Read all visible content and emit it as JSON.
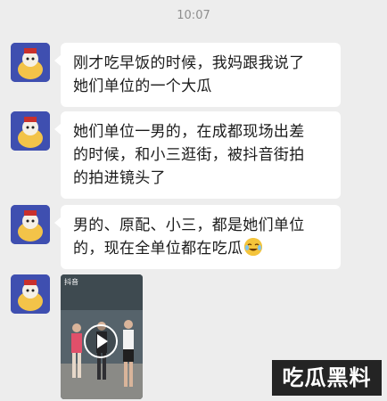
{
  "header": {
    "time": "10:07"
  },
  "messages": [
    {
      "avatar": "ip-mascot-avatar",
      "text": "刚才吃早饭的时候，我妈跟我说了\n她们单位的一个大瓜"
    },
    {
      "avatar": "ip-mascot-avatar",
      "text": "她们单位一男的，在成都现场出差\n的时候，和小三逛街，被抖音街拍\n的拍进镜头了"
    },
    {
      "avatar": "ip-mascot-avatar",
      "text": "男的、原配、小三，都是她们单位\n的，现在全单位都在吃瓜",
      "emoji": "laugh-cry-emoji"
    },
    {
      "avatar": "ip-mascot-avatar",
      "video": {
        "source_label": "抖音",
        "icon": "play-icon"
      }
    }
  ],
  "watermark": "吃瓜黑料",
  "colors": {
    "background": "#ededed",
    "bubble": "#ffffff",
    "time_text": "#8e8e8e"
  }
}
